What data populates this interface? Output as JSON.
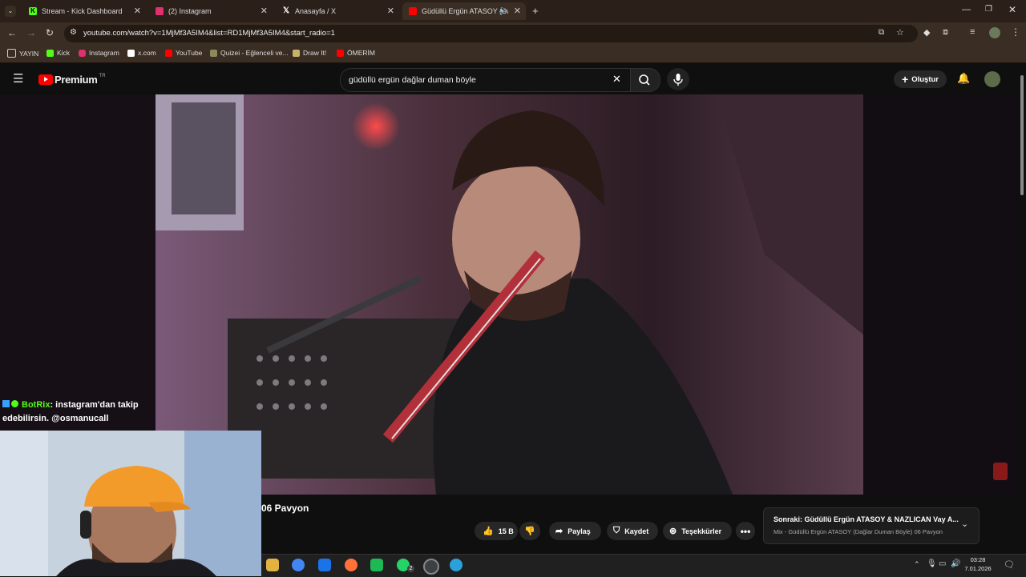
{
  "tabs": [
    {
      "title": "Stream - Kick Dashboard",
      "color": "#53fc18"
    },
    {
      "title": "(2) Instagram",
      "color": "#e1306c"
    },
    {
      "title": "Anasayfa / X",
      "color": "#ffffff"
    },
    {
      "title": "Güdüllü Ergün ATASOY (Da",
      "color": "#ff0000"
    }
  ],
  "address": {
    "url": "youtube.com/watch?v=1MjMf3A5IM4&list=RD1MjMf3A5IM4&start_radio=1"
  },
  "bookmarks": [
    {
      "label": "YAYIN"
    },
    {
      "label": "Kick"
    },
    {
      "label": "Instagram"
    },
    {
      "label": "x.com"
    },
    {
      "label": "YouTube"
    },
    {
      "label": "Quizei - Eğlenceli ve..."
    },
    {
      "label": "Draw It!"
    },
    {
      "label": "ÖMERİM"
    }
  ],
  "youtube": {
    "logo": "Premium",
    "region": "TR",
    "search_value": "güdüllü ergün dağlar duman böyle",
    "create_label": "Oluştur"
  },
  "chat": {
    "user": "BotRix",
    "message": ": instagram'dan takip edebilirsin. @osmanucall"
  },
  "video": {
    "title": "06 Pavyon",
    "likes": "15 B",
    "share": "Paylaş",
    "save": "Kaydet",
    "thanks": "Teşekkürler"
  },
  "next_up": {
    "title": "Sonraki: Güdüllü Ergün ATASOY & NAZLICAN Vay A...",
    "subtitle": "Mix - Güdüllü Ergün ATASOY (Dağlar Duman Böyle) 06 Pavyon"
  },
  "taskbar": {
    "time": "03:28",
    "date": "7.01.2026",
    "whatsapp_badge": "2"
  }
}
